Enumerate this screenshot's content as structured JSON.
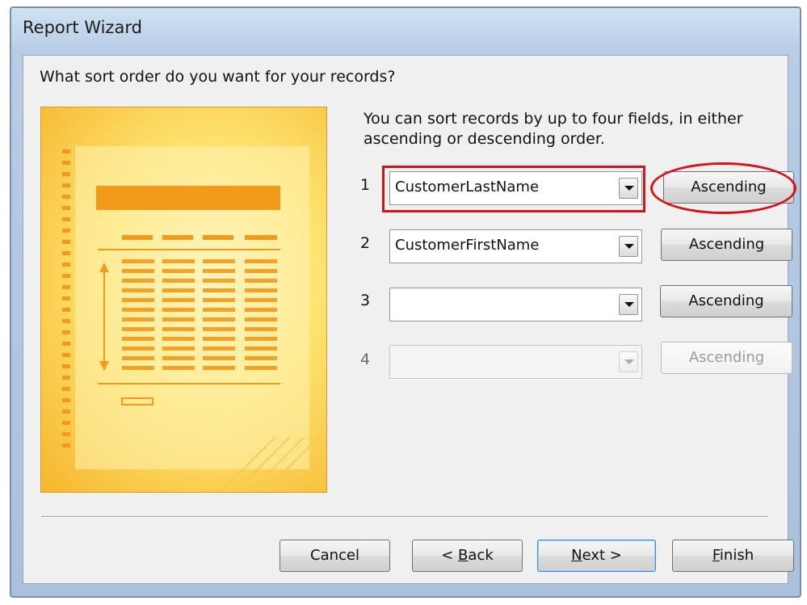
{
  "window": {
    "title": "Report Wizard"
  },
  "question": "What sort order do you want for your records?",
  "intro": "You can sort records by up to four fields, in either ascending or descending order.",
  "sort_rows": [
    {
      "number": "1",
      "field": "CustomerLastName",
      "order": "Ascending",
      "enabled": true
    },
    {
      "number": "2",
      "field": "CustomerFirstName",
      "order": "Ascending",
      "enabled": true
    },
    {
      "number": "3",
      "field": "",
      "order": "Ascending",
      "enabled": true
    },
    {
      "number": "4",
      "field": "",
      "order": "Ascending",
      "enabled": false
    }
  ],
  "footer": {
    "cancel_label": "Cancel",
    "back_mnemonic": "B",
    "back_rest": "ack",
    "back_prefix": "< ",
    "next_mnemonic": "N",
    "next_rest": "ext >",
    "finish_mnemonic": "F",
    "finish_rest": "inish"
  },
  "annotation_color": "#d4141c",
  "preview_colors": {
    "light": "#fff7c6",
    "mid": "#fde36f",
    "dark": "#f6b52c",
    "bar": "#f29a1c"
  }
}
